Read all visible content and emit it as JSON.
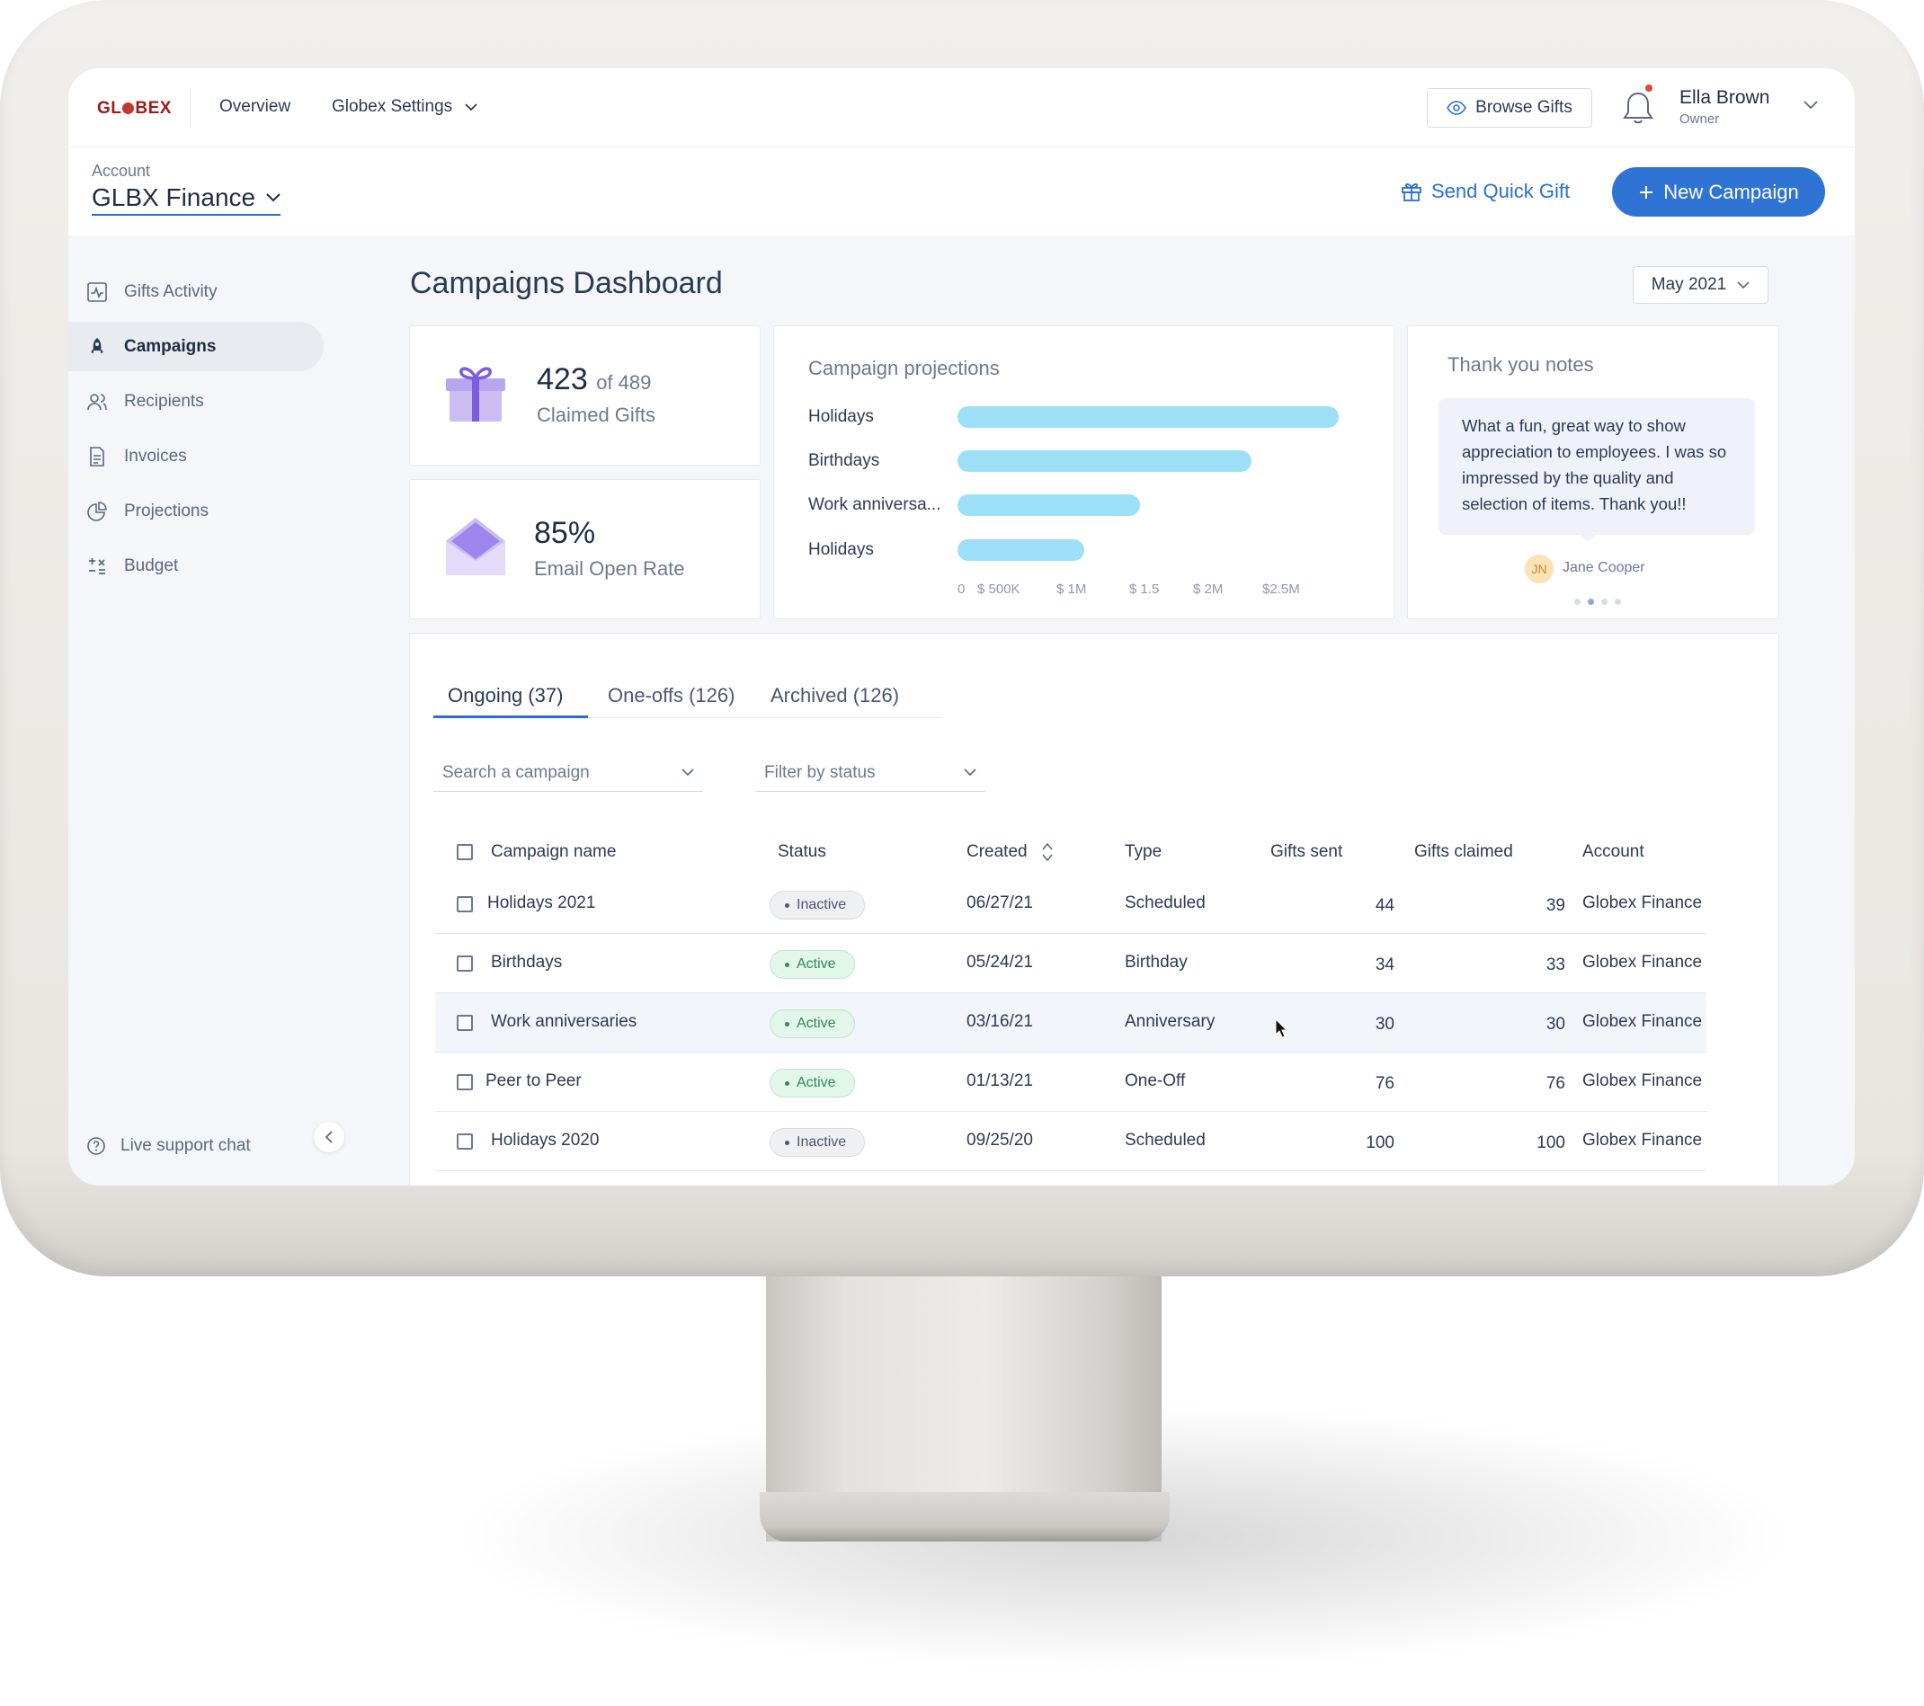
{
  "header": {
    "logo": "GLOBEX",
    "nav": [
      "Overview",
      "Globex Settings"
    ],
    "browse_label": "Browse Gifts",
    "user_name": "Ella Brown",
    "user_role": "Owner"
  },
  "account": {
    "label": "Account",
    "name": "GLBX Finance",
    "quick_gift": "Send Quick Gift",
    "new_campaign": "New Campaign"
  },
  "sidebar": {
    "items": [
      {
        "label": "Gifts Activity",
        "icon": "activity-icon"
      },
      {
        "label": "Campaigns",
        "icon": "rocket-icon"
      },
      {
        "label": "Recipients",
        "icon": "users-icon"
      },
      {
        "label": "Invoices",
        "icon": "document-icon"
      },
      {
        "label": "Projections",
        "icon": "pie-icon"
      },
      {
        "label": "Budget",
        "icon": "budget-icon"
      }
    ],
    "active_index": 1,
    "support": "Live support chat"
  },
  "page": {
    "title": "Campaigns Dashboard",
    "month": "May 2021"
  },
  "stats": {
    "claimed": "423",
    "claimed_of": "of 489",
    "claimed_label": "Claimed Gifts",
    "open_rate": "85%",
    "open_label": "Email Open Rate"
  },
  "chart_data": {
    "type": "bar",
    "orientation": "horizontal",
    "title": "Campaign projections",
    "categories": [
      "Holidays",
      "Birthdays",
      "Work anniversa...",
      "Holidays"
    ],
    "values": [
      2400000,
      1850000,
      1150000,
      800000
    ],
    "tick_labels": [
      "0",
      "$ 500K",
      "$ 1M",
      "$ 1.5",
      "$ 2M",
      "$2.5M"
    ],
    "xlim": [
      0,
      2500000
    ],
    "color": "#9edff8"
  },
  "thank_you": {
    "title": "Thank you notes",
    "text": "What a fun, great way to show appreciation to employees. I was so impressed by the quality and selection of items. Thank you!!",
    "initials": "JN",
    "author": "Jane Cooper",
    "dots": 4,
    "active_dot": 1
  },
  "tabs": [
    "Ongoing (37)",
    "One-offs (126)",
    "Archived (126)"
  ],
  "filters": {
    "search": "Search a campaign",
    "status": "Filter by status"
  },
  "table": {
    "columns": [
      "Campaign name",
      "Status",
      "Created",
      "Type",
      "Gifts sent",
      "Gifts claimed",
      "Account"
    ],
    "rows": [
      {
        "name": "Holidays 2021",
        "status": "Inactive",
        "created": "06/27/21",
        "type": "Scheduled",
        "sent": "44",
        "claimed": "39",
        "account": "Globex Finance"
      },
      {
        "name": "Birthdays",
        "status": "Active",
        "created": "05/24/21",
        "type": "Birthday",
        "sent": "34",
        "claimed": "33",
        "account": "Globex Finance"
      },
      {
        "name": "Work anniversaries",
        "status": "Active",
        "created": "03/16/21",
        "type": "Anniversary",
        "sent": "30",
        "claimed": "30",
        "account": "Globex Finance"
      },
      {
        "name": "Peer to Peer",
        "status": "Active",
        "created": "01/13/21",
        "type": "One-Off",
        "sent": "76",
        "claimed": "76",
        "account": "Globex Finance"
      },
      {
        "name": "Holidays 2020",
        "status": "Inactive",
        "created": "09/25/20",
        "type": "Scheduled",
        "sent": "100",
        "claimed": "100",
        "account": "Globex Finance"
      }
    ]
  }
}
